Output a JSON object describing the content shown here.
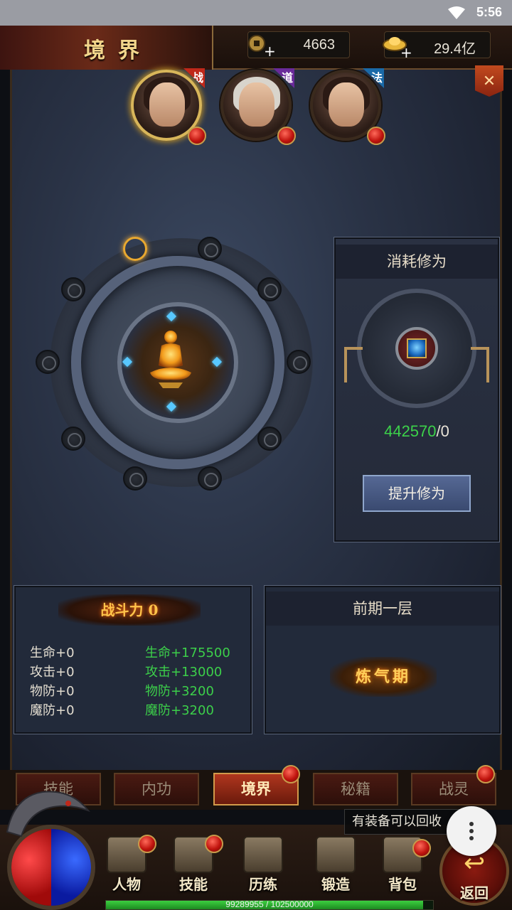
{
  "status_bar": {
    "time": "5:56"
  },
  "header": {
    "title": "境界",
    "copper": "4663",
    "gold": "29.4亿"
  },
  "characters": [
    {
      "class_badge": "战",
      "badge_color": "#c0281a",
      "active": true
    },
    {
      "class_badge": "道",
      "badge_color": "#6a2a9a",
      "active": false
    },
    {
      "class_badge": "法",
      "badge_color": "#1a6aa8",
      "active": false
    }
  ],
  "cost_panel": {
    "title": "消耗修为",
    "current": "442570",
    "separator": "/",
    "required": "0",
    "upgrade_label": "提升修为"
  },
  "power_panel": {
    "power_label": "战斗力",
    "power_value": "0",
    "current_stats": [
      "生命+0",
      "攻击+0",
      "物防+0",
      "魔防+0"
    ],
    "next_stats": [
      "生命+175500",
      "攻击+13000",
      "物防+3200",
      "魔防+3200"
    ]
  },
  "layer_panel": {
    "title": "前期一层",
    "stage_name": "炼气期"
  },
  "tabs": [
    {
      "label": "技能",
      "active": false,
      "alert": false
    },
    {
      "label": "内功",
      "active": false,
      "alert": false
    },
    {
      "label": "境界",
      "active": true,
      "alert": true
    },
    {
      "label": "秘籍",
      "active": false,
      "alert": false
    },
    {
      "label": "战灵",
      "active": false,
      "alert": true
    }
  ],
  "notice": "有装备可以回收",
  "bottom_nav": [
    {
      "label": "人物",
      "alert": true
    },
    {
      "label": "技能",
      "alert": true
    },
    {
      "label": "历练",
      "alert": false
    },
    {
      "label": "锻造",
      "alert": false
    },
    {
      "label": "背包",
      "alert": true
    }
  ],
  "back_label": "返回",
  "xp": {
    "text": "99289955 / 102500000",
    "fraction": 0.9687
  },
  "colors": {
    "gain": "#3cd24a",
    "accent_gold": "#d8b65a"
  }
}
